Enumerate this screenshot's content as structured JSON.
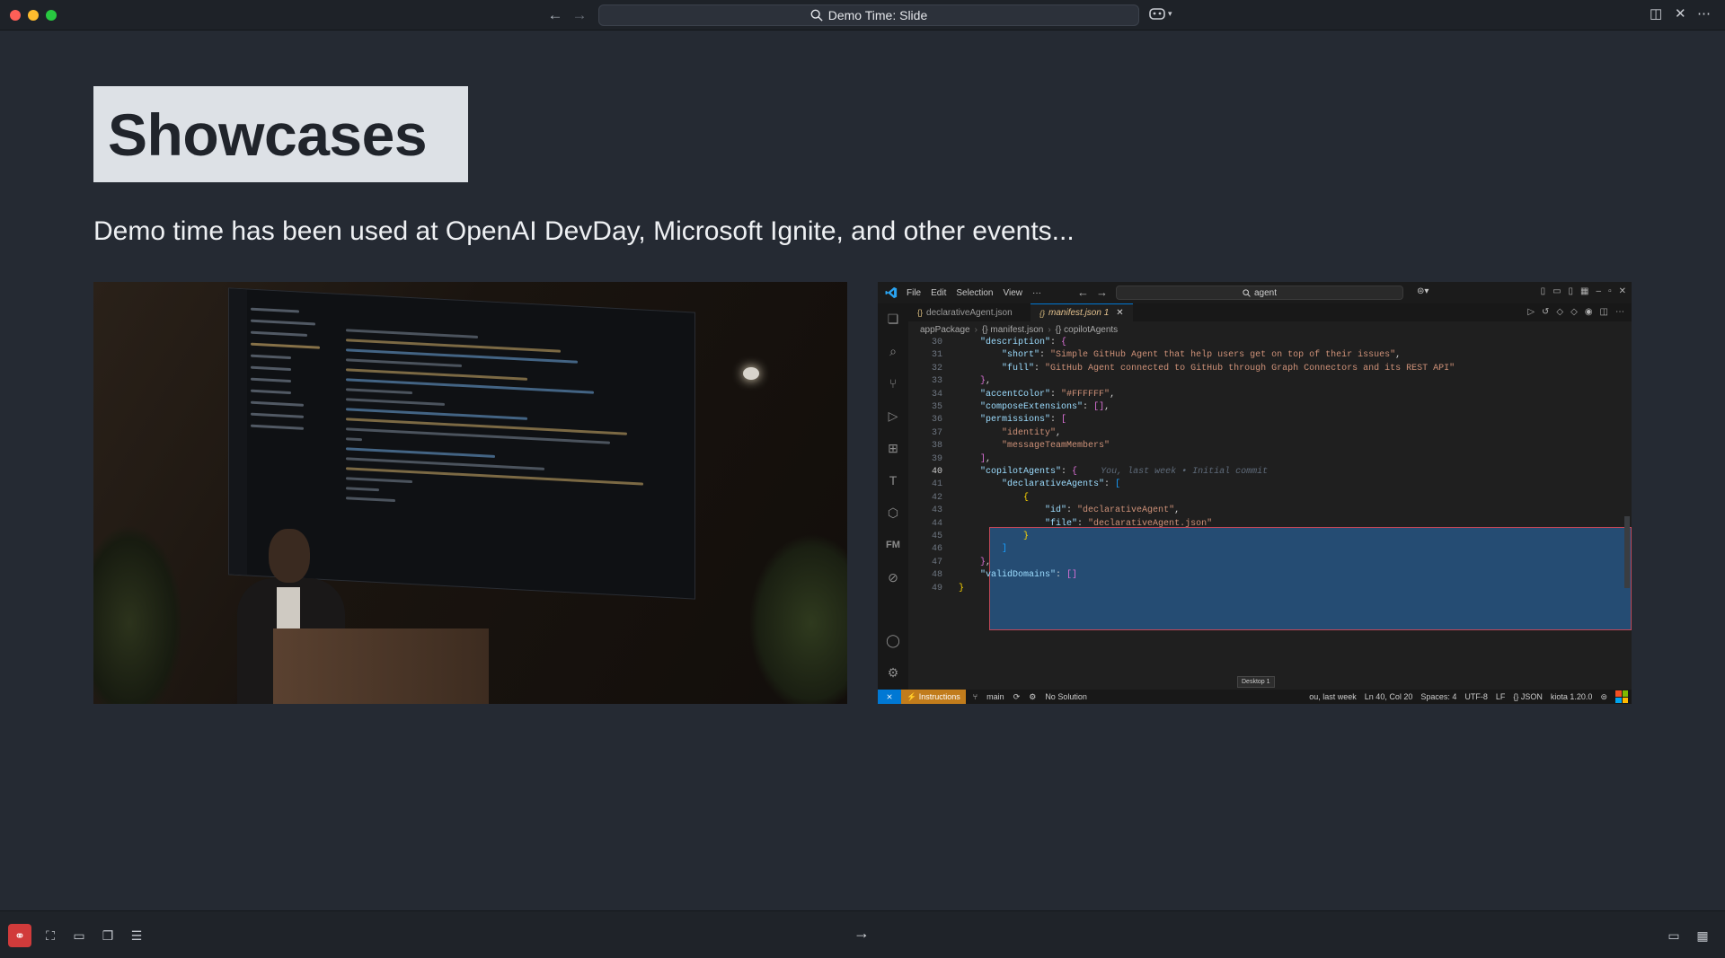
{
  "window": {
    "title": "Demo Time: Slide",
    "colors": {
      "close": "#fe5f57",
      "minimize": "#febc2e",
      "zoom": "#28c840"
    }
  },
  "slide": {
    "title": "Showcases",
    "subtitle": "Demo time has been used at OpenAI DevDay, Microsoft Ignite, and other events..."
  },
  "vscode": {
    "menu": [
      "File",
      "Edit",
      "Selection",
      "View",
      "···"
    ],
    "search": "agent",
    "tabs": [
      {
        "label": "declarativeAgent.json",
        "active": false
      },
      {
        "label": "manifest.json 1",
        "active": true
      }
    ],
    "breadcrumb": [
      "appPackage",
      "{} manifest.json",
      "{} copilotAgents"
    ],
    "ghost_text": "You, last week • Initial commit",
    "status": {
      "branch": "main",
      "instructions": "Instructions",
      "solution": "No Solution",
      "blame": "ou, last week",
      "position": "Ln 40, Col 20",
      "spaces": "Spaces: 4",
      "encoding": "UTF-8",
      "eol": "LF",
      "language": "{} JSON",
      "kiota": "kiota 1.20.0",
      "tooltip": "Desktop 1"
    }
  },
  "bottombar": {
    "buttons": [
      "demo-time-icon",
      "fullscreen-icon",
      "presentation-icon",
      "slides-icon",
      "list-icon"
    ],
    "next_label": "→"
  }
}
